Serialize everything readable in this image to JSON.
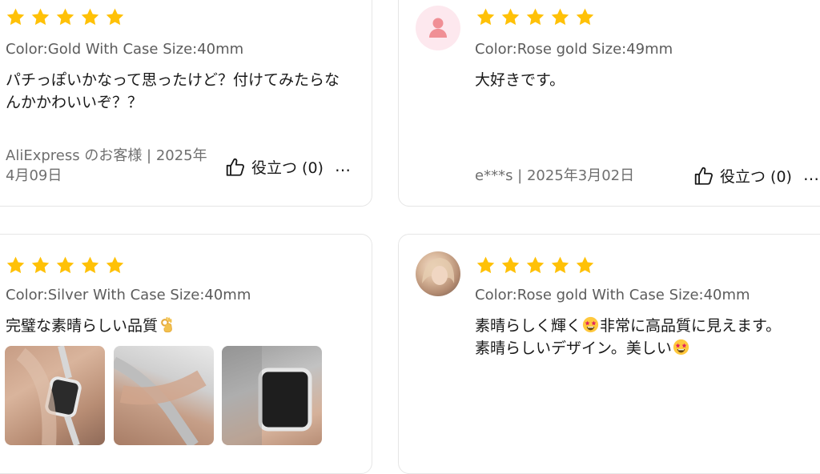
{
  "colors": {
    "star": "#FFC107",
    "text_primary": "#191919",
    "text_secondary": "#5c5c5c",
    "card_border": "#e6e6e6"
  },
  "reviews": [
    {
      "rating": 5,
      "attribute": "Color:Gold With Case Size:40mm",
      "text": "パチっぽいかなって思ったけど？付けてみたらなんかかわいいぞ？？",
      "author_date": "AliExpress のお客様 | 2025年4月09日",
      "helpful_label": "役立つ (0)",
      "more_label": "…"
    },
    {
      "rating": 5,
      "avatar": "default-avatar",
      "attribute": "Color:Rose gold Size:49mm",
      "text": "大好きです。",
      "author_date": "e***s | 2025年3月02日",
      "helpful_label": "役立つ (0)",
      "more_label": "…"
    },
    {
      "rating": 5,
      "attribute": "Color:Silver With Case Size:40mm",
      "text": "完璧な素晴らしい品質",
      "text_emoji": "ok-hand-emoji",
      "photo_count": 3
    },
    {
      "rating": 5,
      "avatar": "user-photo-avatar",
      "attribute": "Color:Rose gold With Case Size:40mm",
      "text_parts": [
        "素晴らしく輝く",
        "非常に高品質に見えます。",
        "素晴らしいデザイン。美しい"
      ],
      "text_emoji": "star-struck-emoji"
    }
  ]
}
